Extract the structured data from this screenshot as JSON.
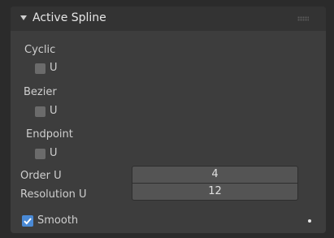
{
  "panel": {
    "title": "Active Spline",
    "collapse_icon": "triangle-down-icon",
    "drag_icon": "grip-icon"
  },
  "cyclic": {
    "label": "Cyclic",
    "checkbox_label": "U",
    "checked": false
  },
  "bezier": {
    "label": "Bezier",
    "checkbox_label": "U",
    "checked": false
  },
  "endpoint": {
    "label": "Endpoint",
    "checkbox_label": "U",
    "checked": false
  },
  "order_u": {
    "label": "Order U",
    "value": "4"
  },
  "resolution_u": {
    "label": "Resolution U",
    "value": "12"
  },
  "smooth": {
    "label": "Smooth",
    "checked": true
  },
  "colors": {
    "accent": "#4a8ad6",
    "panel_bg": "#3d3d3d",
    "header_bg": "#333333",
    "field_bg": "#545454"
  }
}
